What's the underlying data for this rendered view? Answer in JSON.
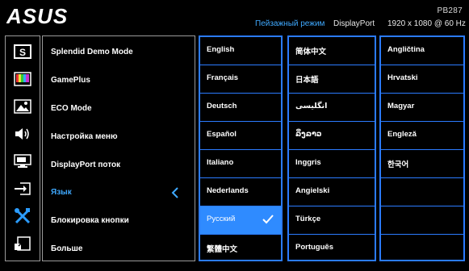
{
  "header": {
    "model": "PB287",
    "mode": "Пейзажный режим",
    "input": "DisplayPort",
    "resolution": "1920 x 1080 @ 60 Hz",
    "logo_text": "ASUS"
  },
  "menu": [
    {
      "label": "Splendid Demo Mode",
      "icon": "splendid-s-icon"
    },
    {
      "label": "GamePlus",
      "icon": "color-bars-icon"
    },
    {
      "label": "ECO Mode",
      "icon": "picture-icon"
    },
    {
      "label": "Настройка меню",
      "icon": "speaker-icon"
    },
    {
      "label": "DisplayPort поток",
      "icon": "monitor-icon"
    },
    {
      "label": "Язык",
      "icon": "input-select-icon",
      "active": true
    },
    {
      "label": "Блокировка кнопки",
      "icon": "wrench-screwdriver-icon"
    },
    {
      "label": "Больше",
      "icon": "shortcut-icon"
    }
  ],
  "languages": {
    "col1": [
      "English",
      "Français",
      "Deutsch",
      "Español",
      "Italiano",
      "Nederlands",
      "Русский",
      "繁體中文"
    ],
    "col2": [
      "简体中文",
      "日本語",
      "انگلیسی",
      "ລິ່ງລາວ",
      "Inggris",
      "Angielski",
      "Türkçe",
      "Português"
    ],
    "col3": [
      "Angličtina",
      "Hrvatski",
      "Magyar",
      "Engleză",
      "한국어",
      "",
      "",
      ""
    ]
  },
  "selected_language": "Русский",
  "colors": {
    "accent": "#2b7bff",
    "selected_bg": "#2f8bff",
    "active_text": "#3fa9ff"
  }
}
